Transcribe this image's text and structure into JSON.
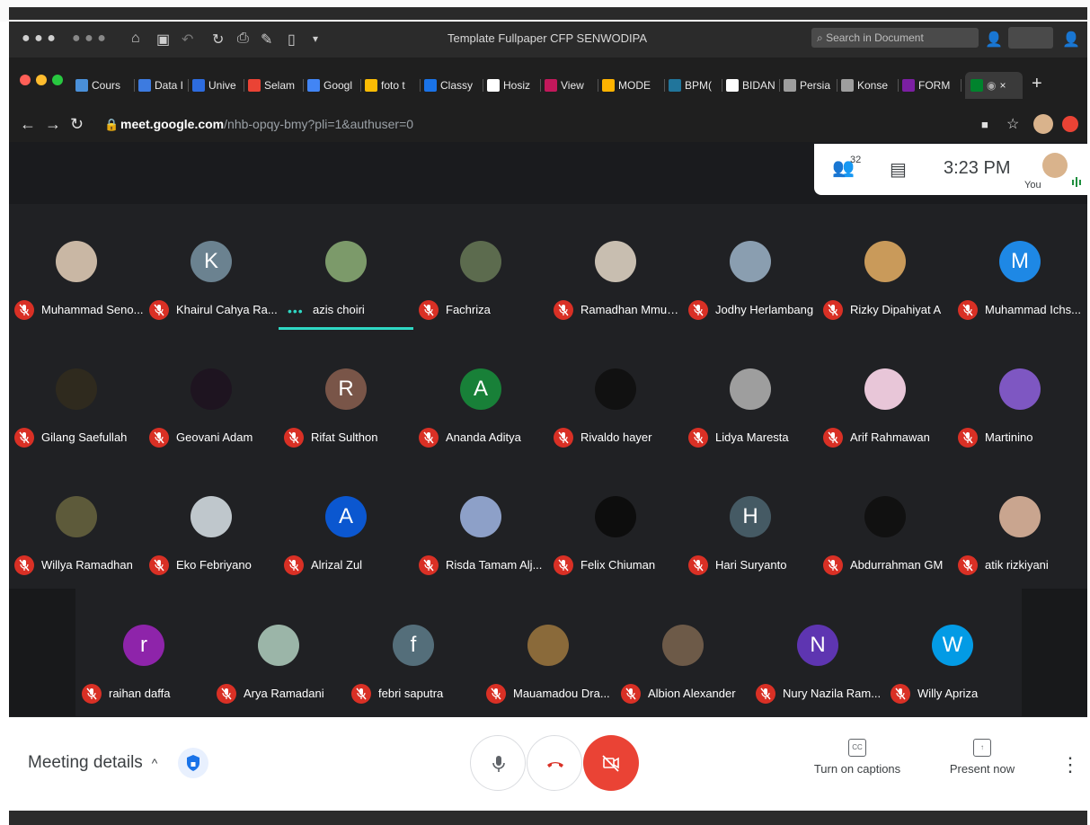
{
  "app": {
    "document_title": "Template Fullpaper CFP SENWODIPA",
    "search_placeholder": "Search in Document"
  },
  "browser": {
    "tabs": [
      {
        "label": "Cours",
        "color": "#4a90d9"
      },
      {
        "label": "Data I",
        "color": "#3d7be0"
      },
      {
        "label": "Unive",
        "color": "#2d6cdf"
      },
      {
        "label": "Selam",
        "color": "#ea4335"
      },
      {
        "label": "Googl",
        "color": "#4285f4"
      },
      {
        "label": "foto t",
        "color": "#fbbc04"
      },
      {
        "label": "Classy",
        "color": "#1a73e8"
      },
      {
        "label": "Hosiz",
        "color": "#ffffff"
      },
      {
        "label": "View",
        "color": "#c2185b"
      },
      {
        "label": "MODE",
        "color": "#ffb300"
      },
      {
        "label": "BPM(",
        "color": "#21759b"
      },
      {
        "label": "BIDAN",
        "color": "#ffffff"
      },
      {
        "label": "Persia",
        "color": "#9e9e9e"
      },
      {
        "label": "Konse",
        "color": "#9e9e9e"
      },
      {
        "label": "FORM",
        "color": "#7b1fa2"
      }
    ],
    "active_tab_close": "×",
    "new_tab": "+",
    "url_host": "meet.google.com",
    "url_path": "/nhb-opqy-bmy?pli=1&authuser=0"
  },
  "meet": {
    "participant_count": "32",
    "time": "3:23 PM",
    "you_label": "You",
    "participants": [
      {
        "name": "Muhammad Seno...",
        "initial": "",
        "color": "#c9b7a4"
      },
      {
        "name": "Khairul Cahya Ra...",
        "initial": "K",
        "color": "#6b8290"
      },
      {
        "name": "azis choiri",
        "initial": "",
        "color": "#7c9a6a",
        "speaking": true
      },
      {
        "name": "Fachriza",
        "initial": "",
        "color": "#5c6b4e"
      },
      {
        "name": "Ramadhan Mmuh...",
        "initial": "",
        "color": "#c8beb0"
      },
      {
        "name": "Jodhy Herlambang",
        "initial": "",
        "color": "#8a9eb0"
      },
      {
        "name": "Rizky Dipahiyat A",
        "initial": "",
        "color": "#c99a5a"
      },
      {
        "name": "Muhammad Ichs...",
        "initial": "M",
        "color": "#1e88e5"
      },
      {
        "name": "Gilang Saefullah",
        "initial": "",
        "color": "#2f2a1e"
      },
      {
        "name": "Geovani Adam",
        "initial": "",
        "color": "#1e1420"
      },
      {
        "name": "Rifat Sulthon",
        "initial": "R",
        "color": "#795548"
      },
      {
        "name": "Ananda Aditya",
        "initial": "A",
        "color": "#188038"
      },
      {
        "name": "Rivaldo hayer",
        "initial": "",
        "color": "#111111"
      },
      {
        "name": "Lidya Maresta",
        "initial": "",
        "color": "#9e9e9e"
      },
      {
        "name": "Arif Rahmawan",
        "initial": "",
        "color": "#e8c6d8"
      },
      {
        "name": "Martinino",
        "initial": "",
        "color": "#7e57c2"
      },
      {
        "name": "Willya Ramadhan",
        "initial": "",
        "color": "#5d5a3a"
      },
      {
        "name": "Eko Febriyano",
        "initial": "",
        "color": "#bfc7cc"
      },
      {
        "name": "Alrizal Zul",
        "initial": "A",
        "color": "#0b57d0"
      },
      {
        "name": "Risda Tamam Alj...",
        "initial": "",
        "color": "#8da0c8"
      },
      {
        "name": "Felix Chiuman",
        "initial": "",
        "color": "#0d0d0d"
      },
      {
        "name": "Hari Suryanto",
        "initial": "H",
        "color": "#455a64"
      },
      {
        "name": "Abdurrahman GM",
        "initial": "",
        "color": "#111111"
      },
      {
        "name": "atik rizkiyani",
        "initial": "",
        "color": "#c9a58f"
      },
      {
        "name": "raihan daffa",
        "initial": "r",
        "color": "#8e24aa"
      },
      {
        "name": "Arya Ramadani",
        "initial": "",
        "color": "#9bb5a8"
      },
      {
        "name": "febri saputra",
        "initial": "f",
        "color": "#546e7a"
      },
      {
        "name": "Mauamadou Dra...",
        "initial": "",
        "color": "#8a6a3a"
      },
      {
        "name": "Albion Alexander",
        "initial": "",
        "color": "#6d5a48"
      },
      {
        "name": "Nury Nazila Ram...",
        "initial": "N",
        "color": "#5e35b1"
      },
      {
        "name": "Willy Apriza",
        "initial": "W",
        "color": "#039be5"
      }
    ]
  },
  "controls": {
    "meeting_details": "Meeting details",
    "captions_label": "Turn on captions",
    "captions_icon": "CC",
    "present_label": "Present now",
    "present_icon": "↑"
  }
}
